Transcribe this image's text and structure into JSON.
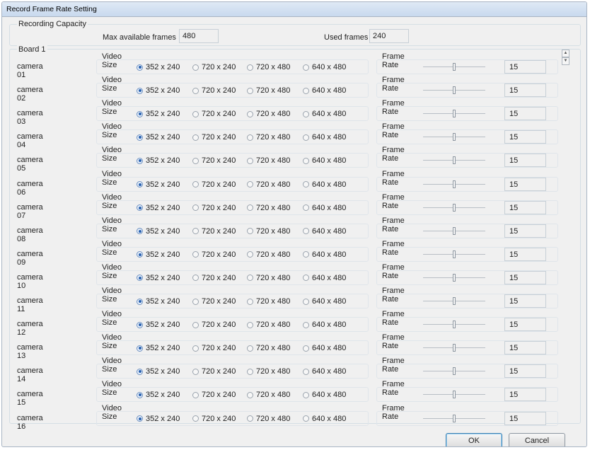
{
  "window": {
    "title": "Record Frame Rate Setting"
  },
  "capacity": {
    "group_label": "Recording Capacity",
    "max_label": "Max available frames",
    "max_value": "480",
    "used_label": "Used frames",
    "used_value": "240"
  },
  "board": {
    "label": "Board 1"
  },
  "section_labels": {
    "video_size": "Video Size",
    "frame_rate": "Frame Rate"
  },
  "video_size_options": [
    "352 x 240",
    "720 x 240",
    "720 x 480",
    "640 x 480"
  ],
  "cameras": [
    {
      "name": "camera 01",
      "selected_size": 0,
      "frame_rate": "15"
    },
    {
      "name": "camera 02",
      "selected_size": 0,
      "frame_rate": "15"
    },
    {
      "name": "camera 03",
      "selected_size": 0,
      "frame_rate": "15"
    },
    {
      "name": "camera 04",
      "selected_size": 0,
      "frame_rate": "15"
    },
    {
      "name": "camera 05",
      "selected_size": 0,
      "frame_rate": "15"
    },
    {
      "name": "camera 06",
      "selected_size": 0,
      "frame_rate": "15"
    },
    {
      "name": "camera 07",
      "selected_size": 0,
      "frame_rate": "15"
    },
    {
      "name": "camera 08",
      "selected_size": 0,
      "frame_rate": "15"
    },
    {
      "name": "camera 09",
      "selected_size": 0,
      "frame_rate": "15"
    },
    {
      "name": "camera 10",
      "selected_size": 0,
      "frame_rate": "15"
    },
    {
      "name": "camera 11",
      "selected_size": 0,
      "frame_rate": "15"
    },
    {
      "name": "camera 12",
      "selected_size": 0,
      "frame_rate": "15"
    },
    {
      "name": "camera 13",
      "selected_size": 0,
      "frame_rate": "15"
    },
    {
      "name": "camera 14",
      "selected_size": 0,
      "frame_rate": "15"
    },
    {
      "name": "camera 15",
      "selected_size": 0,
      "frame_rate": "15"
    },
    {
      "name": "camera 16",
      "selected_size": 0,
      "frame_rate": "15"
    }
  ],
  "slider_level": 0.5,
  "buttons": {
    "ok": "OK",
    "cancel": "Cancel"
  },
  "icons": {
    "scroll_up": "scroll-up-arrow",
    "scroll_down": "scroll-down-arrow"
  },
  "colors": {
    "accent": "#2a62b0",
    "titlebar": "#c8d9ee",
    "dialog_bg": "#f0f0f0"
  }
}
